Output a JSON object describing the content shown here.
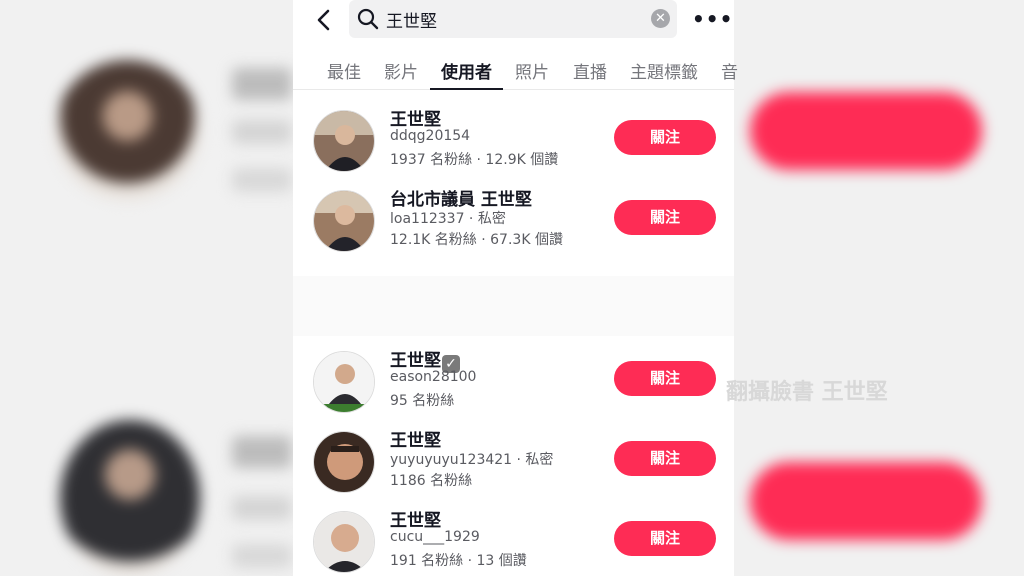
{
  "search": {
    "query": "王世堅"
  },
  "tabs": [
    {
      "label": "最佳"
    },
    {
      "label": "影片"
    },
    {
      "label": "使用者"
    },
    {
      "label": "照片"
    },
    {
      "label": "直播"
    },
    {
      "label": "主題標籤"
    },
    {
      "label": "音"
    }
  ],
  "active_tab": "使用者",
  "users": [
    {
      "name": "王世堅",
      "handle": "ddqg20154",
      "stats": "1937 名粉絲 · 12.9K 個讚",
      "follow_label": "關注"
    },
    {
      "name": "台北市議員 王世堅",
      "handle": "loa112337 · 私密",
      "stats": "12.1K 名粉絲 · 67.3K 個讚",
      "follow_label": "關注"
    },
    {
      "name": "王世堅",
      "verified_icon": "✓",
      "handle": "eason28100",
      "stats": "95 名粉絲",
      "follow_label": "關注"
    },
    {
      "name": "王世堅",
      "handle": "yuyuyuyu123421 · 私密",
      "stats": "1186 名粉絲",
      "follow_label": "關注"
    },
    {
      "name": "王世堅",
      "handle": "cucu___1929",
      "stats": "191 名粉絲 · 13 個讚",
      "follow_label": "關注"
    }
  ],
  "caption": "翻攝臉書 王世堅",
  "icons": {
    "back": "back-arrow-icon",
    "search": "search-icon",
    "clear": "clear-icon",
    "more": "more-icon",
    "verified": "verified-icon"
  },
  "colors": {
    "accent": "#fe2c55",
    "text": "#161823",
    "secondary": "#5a5b61"
  }
}
